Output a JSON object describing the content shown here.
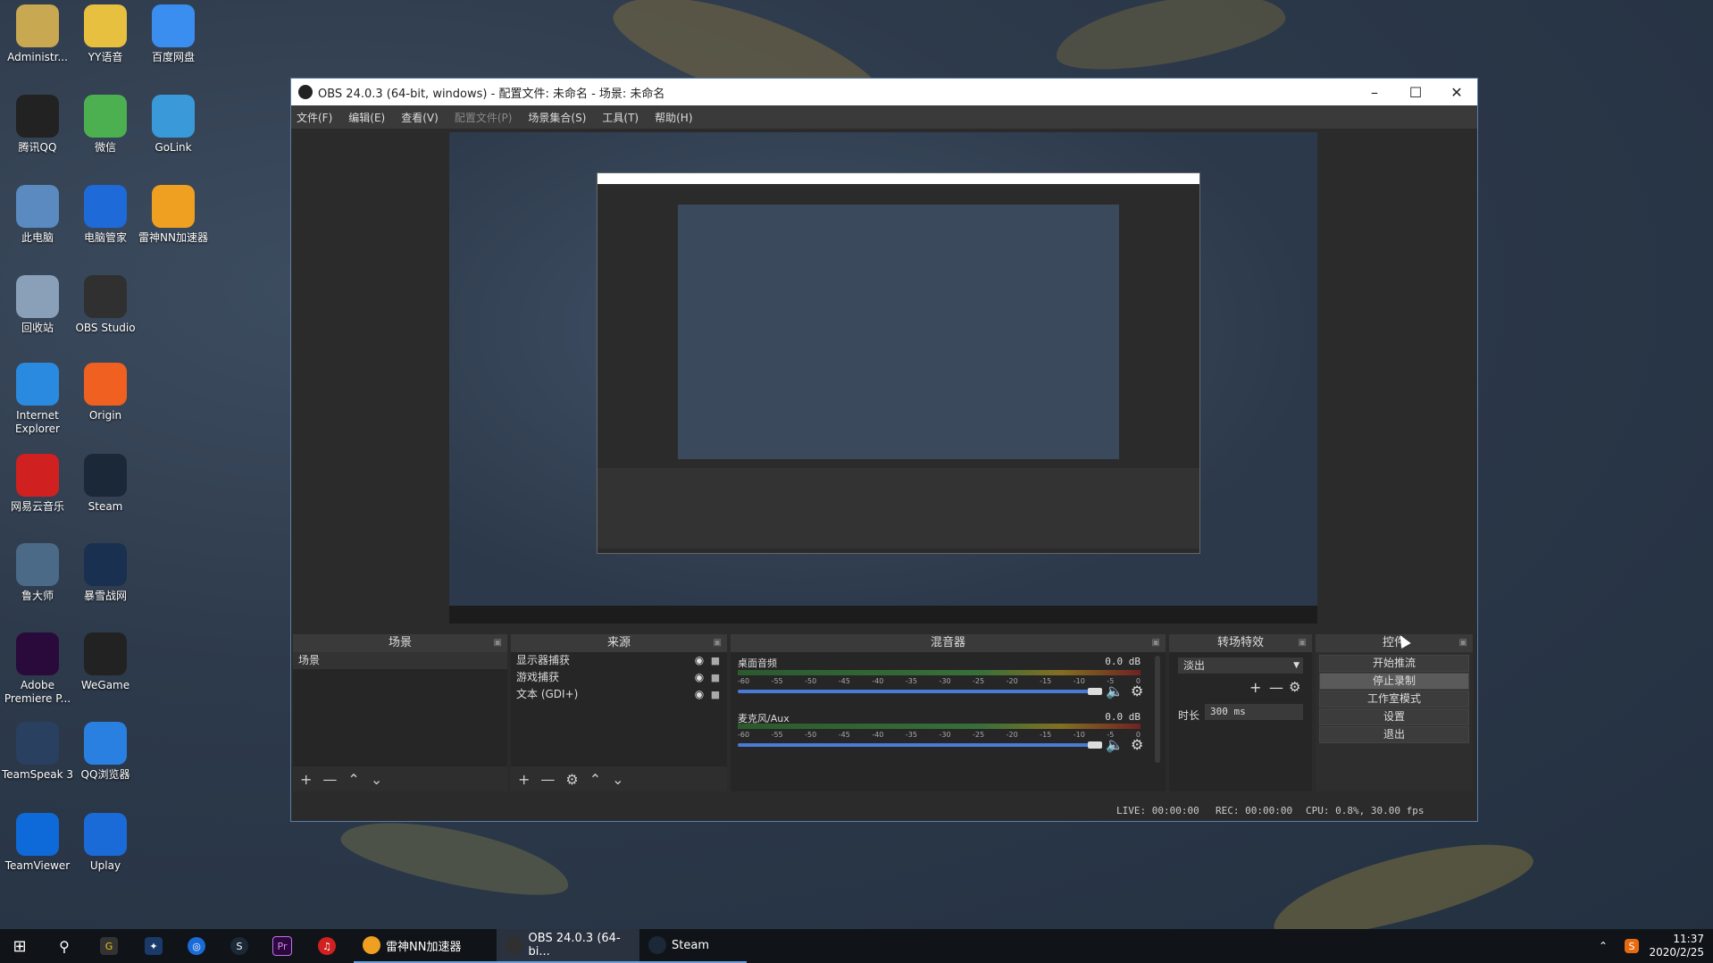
{
  "desktop": {
    "icons": [
      {
        "label": "Administr...",
        "icon": "user-folder-icon",
        "color": "#c8a850"
      },
      {
        "label": "YY语音",
        "icon": "yy-icon",
        "color": "#e8c040"
      },
      {
        "label": "百度网盘",
        "icon": "baidu-netdisk-icon",
        "color": "#3a8ef0"
      },
      {
        "label": "腾讯QQ",
        "icon": "qq-icon",
        "color": "#222222"
      },
      {
        "label": "微信",
        "icon": "wechat-icon",
        "color": "#4caf50"
      },
      {
        "label": "GoLink",
        "icon": "golink-icon",
        "color": "#3a9ad9"
      },
      {
        "label": "此电脑",
        "icon": "computer-icon",
        "color": "#5a8ac0"
      },
      {
        "label": "电脑管家",
        "icon": "pc-manager-icon",
        "color": "#1e6ad8"
      },
      {
        "label": "雷神NN加速器",
        "icon": "nn-accelerator-icon",
        "color": "#f0a020"
      },
      {
        "label": "回收站",
        "icon": "recycle-bin-icon",
        "color": "#8aa0b8"
      },
      {
        "label": "OBS Studio",
        "icon": "obs-icon",
        "color": "#303030"
      },
      {
        "label": "Internet Explorer",
        "icon": "ie-icon",
        "color": "#2a8ae0"
      },
      {
        "label": "Origin",
        "icon": "origin-icon",
        "color": "#f06020"
      },
      {
        "label": "网易云音乐",
        "icon": "netease-music-icon",
        "color": "#d02020"
      },
      {
        "label": "Steam",
        "icon": "steam-icon",
        "color": "#1b2838"
      },
      {
        "label": "鲁大师",
        "icon": "ludashi-icon",
        "color": "#4a6a88"
      },
      {
        "label": "暴雪战网",
        "icon": "battlenet-icon",
        "color": "#1a3050"
      },
      {
        "label": "Adobe Premiere P...",
        "icon": "premiere-icon",
        "color": "#2a0a3a"
      },
      {
        "label": "WeGame",
        "icon": "wegame-icon",
        "color": "#222222"
      },
      {
        "label": "TeamSpeak 3",
        "icon": "teamspeak-icon",
        "color": "#2a4060"
      },
      {
        "label": "QQ浏览器",
        "icon": "qq-browser-icon",
        "color": "#2a80e0"
      },
      {
        "label": "TeamViewer",
        "icon": "teamviewer-icon",
        "color": "#0e6ad8"
      },
      {
        "label": "Uplay",
        "icon": "uplay-icon",
        "color": "#1a6ad8"
      }
    ]
  },
  "obs": {
    "title": "OBS 24.0.3 (64-bit, windows) - 配置文件: 未命名 - 场景: 未命名",
    "menu": [
      "文件(F)",
      "编辑(E)",
      "查看(V)",
      "配置文件(P)",
      "场景集合(S)",
      "工具(T)",
      "帮助(H)"
    ],
    "scenes": {
      "title": "场景",
      "items": [
        "场景"
      ]
    },
    "sources": {
      "title": "来源",
      "items": [
        "显示器捕获",
        "游戏捕获",
        "文本 (GDI+)"
      ]
    },
    "mixer": {
      "title": "混音器",
      "channels": [
        {
          "name": "桌面音频",
          "level": "0.0 dB",
          "volume": 0.99
        },
        {
          "name": "麦克风/Aux",
          "level": "0.0 dB",
          "volume": 0.99
        }
      ],
      "ticks": [
        "-60",
        "-55",
        "-50",
        "-45",
        "-40",
        "-35",
        "-30",
        "-25",
        "-20",
        "-15",
        "-10",
        "-5",
        "0"
      ]
    },
    "transitions": {
      "title": "转场特效",
      "selected": "淡出",
      "duration_label": "时长",
      "duration_value": "300 ms"
    },
    "controls": {
      "title": "控件",
      "buttons": [
        "开始推流",
        "停止录制",
        "工作室模式",
        "设置",
        "退出"
      ]
    },
    "status": {
      "live": "LIVE: 00:00:00",
      "rec": "REC: 00:00:00",
      "cpu": "CPU: 0.8%, 30.00 fps"
    }
  },
  "taskbar": {
    "apps": [
      {
        "label": "雷神NN加速器"
      },
      {
        "label": "OBS 24.0.3 (64-bi..."
      },
      {
        "label": "Steam"
      }
    ],
    "time": "11:37",
    "date": "2020/2/25"
  }
}
